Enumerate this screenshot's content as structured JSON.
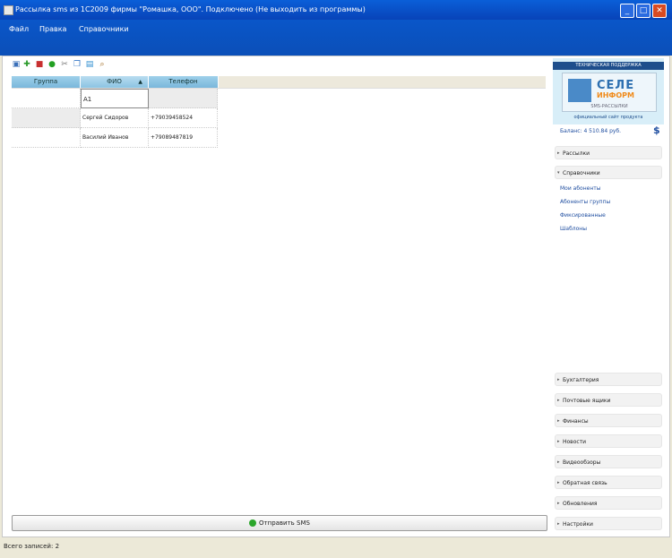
{
  "window": {
    "title": "Рассылка sms из 1С2009 фирмы \"Ромашка, ООО\". Подключено (Не выходить из программы)",
    "min_glyph": "_",
    "max_glyph": "□",
    "close_glyph": "✕"
  },
  "menu": {
    "items": [
      "Файл",
      "Правка",
      "Справочники"
    ]
  },
  "toolbar": {
    "icons": [
      "new-icon",
      "add-icon",
      "delete-icon",
      "add-green-icon",
      "cut-icon",
      "copy-icon",
      "export-icon",
      "search-icon"
    ]
  },
  "grid": {
    "columns": [
      "Группа",
      "ФИО",
      "Телефон"
    ],
    "sorted_column": "ФИО",
    "edit_value": "А1",
    "rows": [
      {
        "group": "",
        "name": "Сергей Сидоров",
        "phone": "+79039458524"
      },
      {
        "group": "",
        "name": "Василий Иванов",
        "phone": "+79089487819"
      }
    ]
  },
  "send_button": {
    "label": "Отправить SMS"
  },
  "sidebar": {
    "logo": {
      "band": "ТЕХНИЧЕСКАЯ ПОДДЕРЖКА",
      "brand_top": "СЕЛЕ",
      "brand_bottom": "ИНФОРМ",
      "brand_sub": "SMS-РАССЫЛКИ",
      "tagline": "официальный сайт продукта"
    },
    "balance": "Баланс: 4 510.84 руб.",
    "dollar": "$",
    "sections_top": [
      {
        "label": "Рассылки",
        "expanded": false
      },
      {
        "label": "Справочники",
        "expanded": true
      }
    ],
    "sublinks": [
      "Мои абоненты",
      "Абоненты группы",
      "Фиксированные",
      "Шаблоны"
    ],
    "sections_bottom": [
      {
        "label": "Бухгалтерия"
      },
      {
        "label": "Почтовые ящики"
      },
      {
        "label": "Финансы"
      },
      {
        "label": "Новости"
      },
      {
        "label": "Видеообзоры"
      },
      {
        "label": "Обратная связь"
      },
      {
        "label": "Обновления"
      },
      {
        "label": "Настройки"
      }
    ]
  },
  "status": {
    "text": "Всего записей: 2"
  }
}
